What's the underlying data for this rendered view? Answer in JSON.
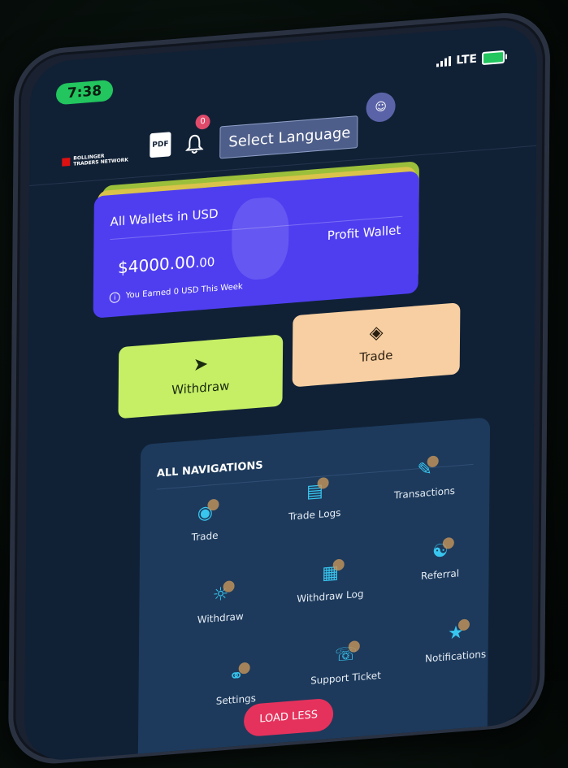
{
  "status": {
    "time": "7:38",
    "network": "LTE"
  },
  "header": {
    "logo_line1": "BOLLINGER",
    "logo_line2": "TRADERS NETWORK",
    "pdf_label": "PDF",
    "notification_count": "0",
    "language_select": "Select Language"
  },
  "wallet": {
    "title": "All Wallets in USD",
    "amount": "$4000.00",
    "amount_cents": ".00",
    "label": "Profit Wallet",
    "note": "You Earned 0 USD This Week"
  },
  "actions": {
    "withdraw": "Withdraw",
    "trade": "Trade"
  },
  "navigation": {
    "title": "ALL NAVIGATIONS",
    "items": [
      {
        "label": "Trade",
        "icon": "eye-icon"
      },
      {
        "label": "Trade Logs",
        "icon": "newspaper-icon"
      },
      {
        "label": "Transactions",
        "icon": "document-pen-icon"
      },
      {
        "label": "Withdraw",
        "icon": "lightbulb-icon"
      },
      {
        "label": "Withdraw Log",
        "icon": "calendar-icon"
      },
      {
        "label": "Referral",
        "icon": "network-icon"
      },
      {
        "label": "Settings",
        "icon": "share-icon"
      },
      {
        "label": "Support Ticket",
        "icon": "headset-icon"
      },
      {
        "label": "Notifications",
        "icon": "medal-icon"
      }
    ],
    "load_less": "LOAD LESS"
  },
  "colors": {
    "screen_bg": "#102136",
    "wallet_card": "#4f3ef0",
    "withdraw_btn": "#c6ef65",
    "trade_btn": "#f8cfa2",
    "accent_pink": "#e5325c",
    "icon_cyan": "#38c6ef"
  }
}
